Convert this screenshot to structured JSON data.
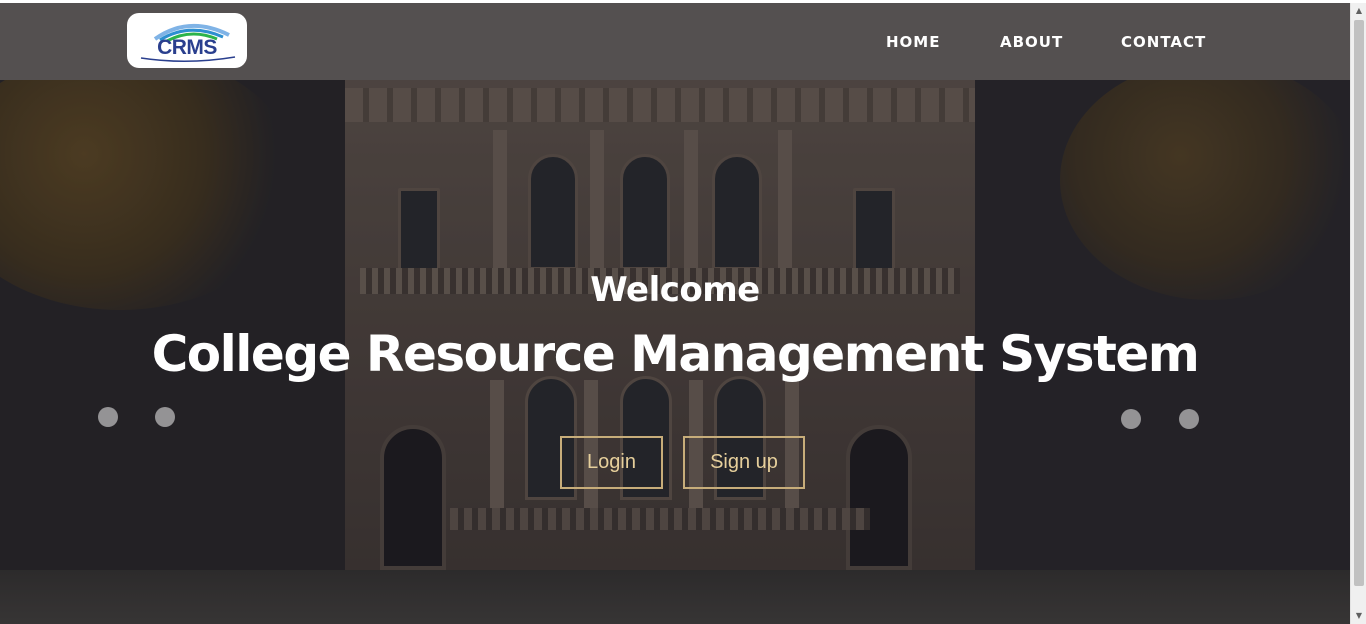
{
  "header": {
    "logo_text": "CRMS",
    "nav": [
      {
        "label": "HOME"
      },
      {
        "label": "ABOUT"
      },
      {
        "label": "CONTACT"
      }
    ]
  },
  "hero": {
    "subtitle": "Welcome",
    "title": "College Resource Management System",
    "buttons": {
      "login": "Login",
      "signup": "Sign up"
    }
  },
  "colors": {
    "navbar_bg": "#545050",
    "button_border": "#c7ad7a",
    "logo_blue": "#2a3f8e"
  },
  "icons": {
    "logo_arcs": "logo-arcs",
    "scroll_up": "▲",
    "scroll_down": "▼"
  }
}
